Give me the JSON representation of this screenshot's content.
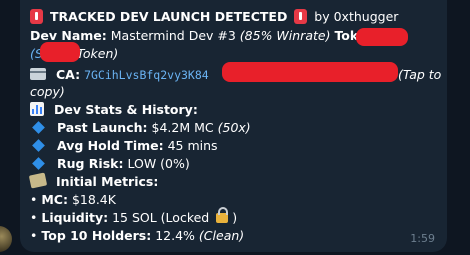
{
  "message": {
    "title": "TRACKED DEV LAUNCH DETECTED",
    "by": "by 0xthugger",
    "dev_name_label": "Dev Name:",
    "dev_name_value": "Mastermind Dev #3",
    "winrate": "(85% Winrate)",
    "token_label": "Token:",
    "token_ticker": "$S",
    "token_name_prefix": "(S",
    "token_name_suffix": "Token)",
    "ca_label": "CA:",
    "ca_value": "7GCihLvsBfq2vy3K84",
    "ca_hint": "(Tap to",
    "ca_hint_cont": "copy)",
    "stats_heading": "Dev Stats & History:",
    "past_launch_label": "Past Launch:",
    "past_launch_value": "$4.2M MC",
    "past_launch_multiple": "(50x)",
    "hold_label": "Avg Hold Time:",
    "hold_value": "45 mins",
    "rug_label": "Rug Risk:",
    "rug_value": "LOW (0%)",
    "metrics_heading": "Initial Metrics:",
    "mc_label": "MC:",
    "mc_value": "$18.4K",
    "liq_label": "Liquidity:",
    "liq_value": "15 SOL (Locked",
    "liq_close": ")",
    "holders_label": "Top 10 Holders:",
    "holders_value": "12.4%",
    "holders_note": "(Clean)",
    "bullet": "•",
    "time": "1:59"
  },
  "icons": [
    "siren-icon",
    "id-card-icon",
    "bar-chart-icon",
    "diamond-icon",
    "money-icon",
    "lock-icon"
  ],
  "colors": {
    "background": "#0e1621",
    "bubble": "#182533",
    "link": "#6ab3f3",
    "redaction": "#e8202a",
    "timestamp": "#6d7f8f"
  }
}
